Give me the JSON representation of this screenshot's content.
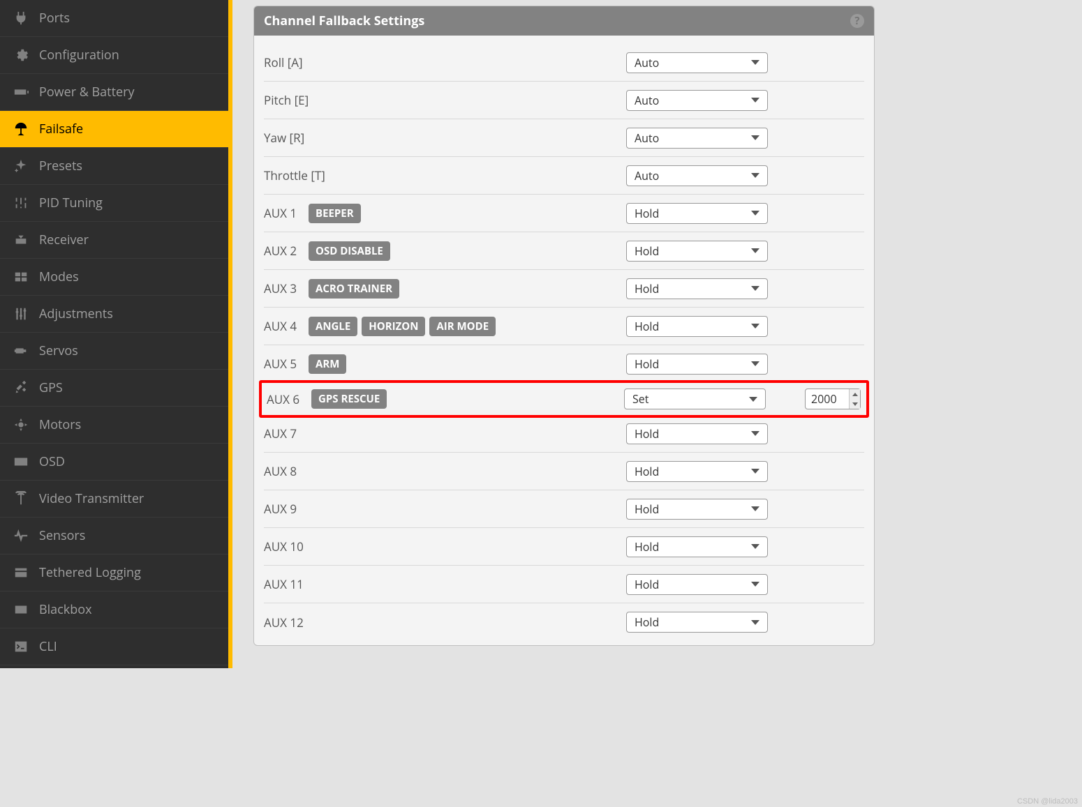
{
  "sidebar": {
    "items": [
      {
        "label": "Ports",
        "icon": "plug-icon"
      },
      {
        "label": "Configuration",
        "icon": "gear-icon"
      },
      {
        "label": "Power & Battery",
        "icon": "battery-icon"
      },
      {
        "label": "Failsafe",
        "icon": "parachute-icon",
        "active": true
      },
      {
        "label": "Presets",
        "icon": "sparkle-icon"
      },
      {
        "label": "PID Tuning",
        "icon": "sliders-icon"
      },
      {
        "label": "Receiver",
        "icon": "receiver-icon"
      },
      {
        "label": "Modes",
        "icon": "modes-icon"
      },
      {
        "label": "Adjustments",
        "icon": "adjust-icon"
      },
      {
        "label": "Servos",
        "icon": "servo-icon"
      },
      {
        "label": "GPS",
        "icon": "satellite-icon"
      },
      {
        "label": "Motors",
        "icon": "motor-icon"
      },
      {
        "label": "OSD",
        "icon": "osd-icon"
      },
      {
        "label": "Video Transmitter",
        "icon": "antenna-icon"
      },
      {
        "label": "Sensors",
        "icon": "pulse-icon"
      },
      {
        "label": "Tethered Logging",
        "icon": "log-icon"
      },
      {
        "label": "Blackbox",
        "icon": "blackbox-icon"
      },
      {
        "label": "CLI",
        "icon": "terminal-icon"
      }
    ]
  },
  "panel": {
    "title": "Channel Fallback Settings",
    "rows": [
      {
        "label": "Roll [A]",
        "badges": [],
        "value": "Auto"
      },
      {
        "label": "Pitch [E]",
        "badges": [],
        "value": "Auto"
      },
      {
        "label": "Yaw [R]",
        "badges": [],
        "value": "Auto"
      },
      {
        "label": "Throttle [T]",
        "badges": [],
        "value": "Auto"
      },
      {
        "label": "AUX 1",
        "badges": [
          "BEEPER"
        ],
        "value": "Hold"
      },
      {
        "label": "AUX 2",
        "badges": [
          "OSD DISABLE"
        ],
        "value": "Hold"
      },
      {
        "label": "AUX 3",
        "badges": [
          "ACRO TRAINER"
        ],
        "value": "Hold"
      },
      {
        "label": "AUX 4",
        "badges": [
          "ANGLE",
          "HORIZON",
          "AIR MODE"
        ],
        "value": "Hold"
      },
      {
        "label": "AUX 5",
        "badges": [
          "ARM"
        ],
        "value": "Hold"
      },
      {
        "label": "AUX 6",
        "badges": [
          "GPS RESCUE"
        ],
        "value": "Set",
        "set_value": "2000",
        "highlight": true
      },
      {
        "label": "AUX 7",
        "badges": [],
        "value": "Hold"
      },
      {
        "label": "AUX 8",
        "badges": [],
        "value": "Hold"
      },
      {
        "label": "AUX 9",
        "badges": [],
        "value": "Hold"
      },
      {
        "label": "AUX 10",
        "badges": [],
        "value": "Hold"
      },
      {
        "label": "AUX 11",
        "badges": [],
        "value": "Hold"
      },
      {
        "label": "AUX 12",
        "badges": [],
        "value": "Hold"
      }
    ]
  },
  "watermark": "CSDN @lida2003"
}
